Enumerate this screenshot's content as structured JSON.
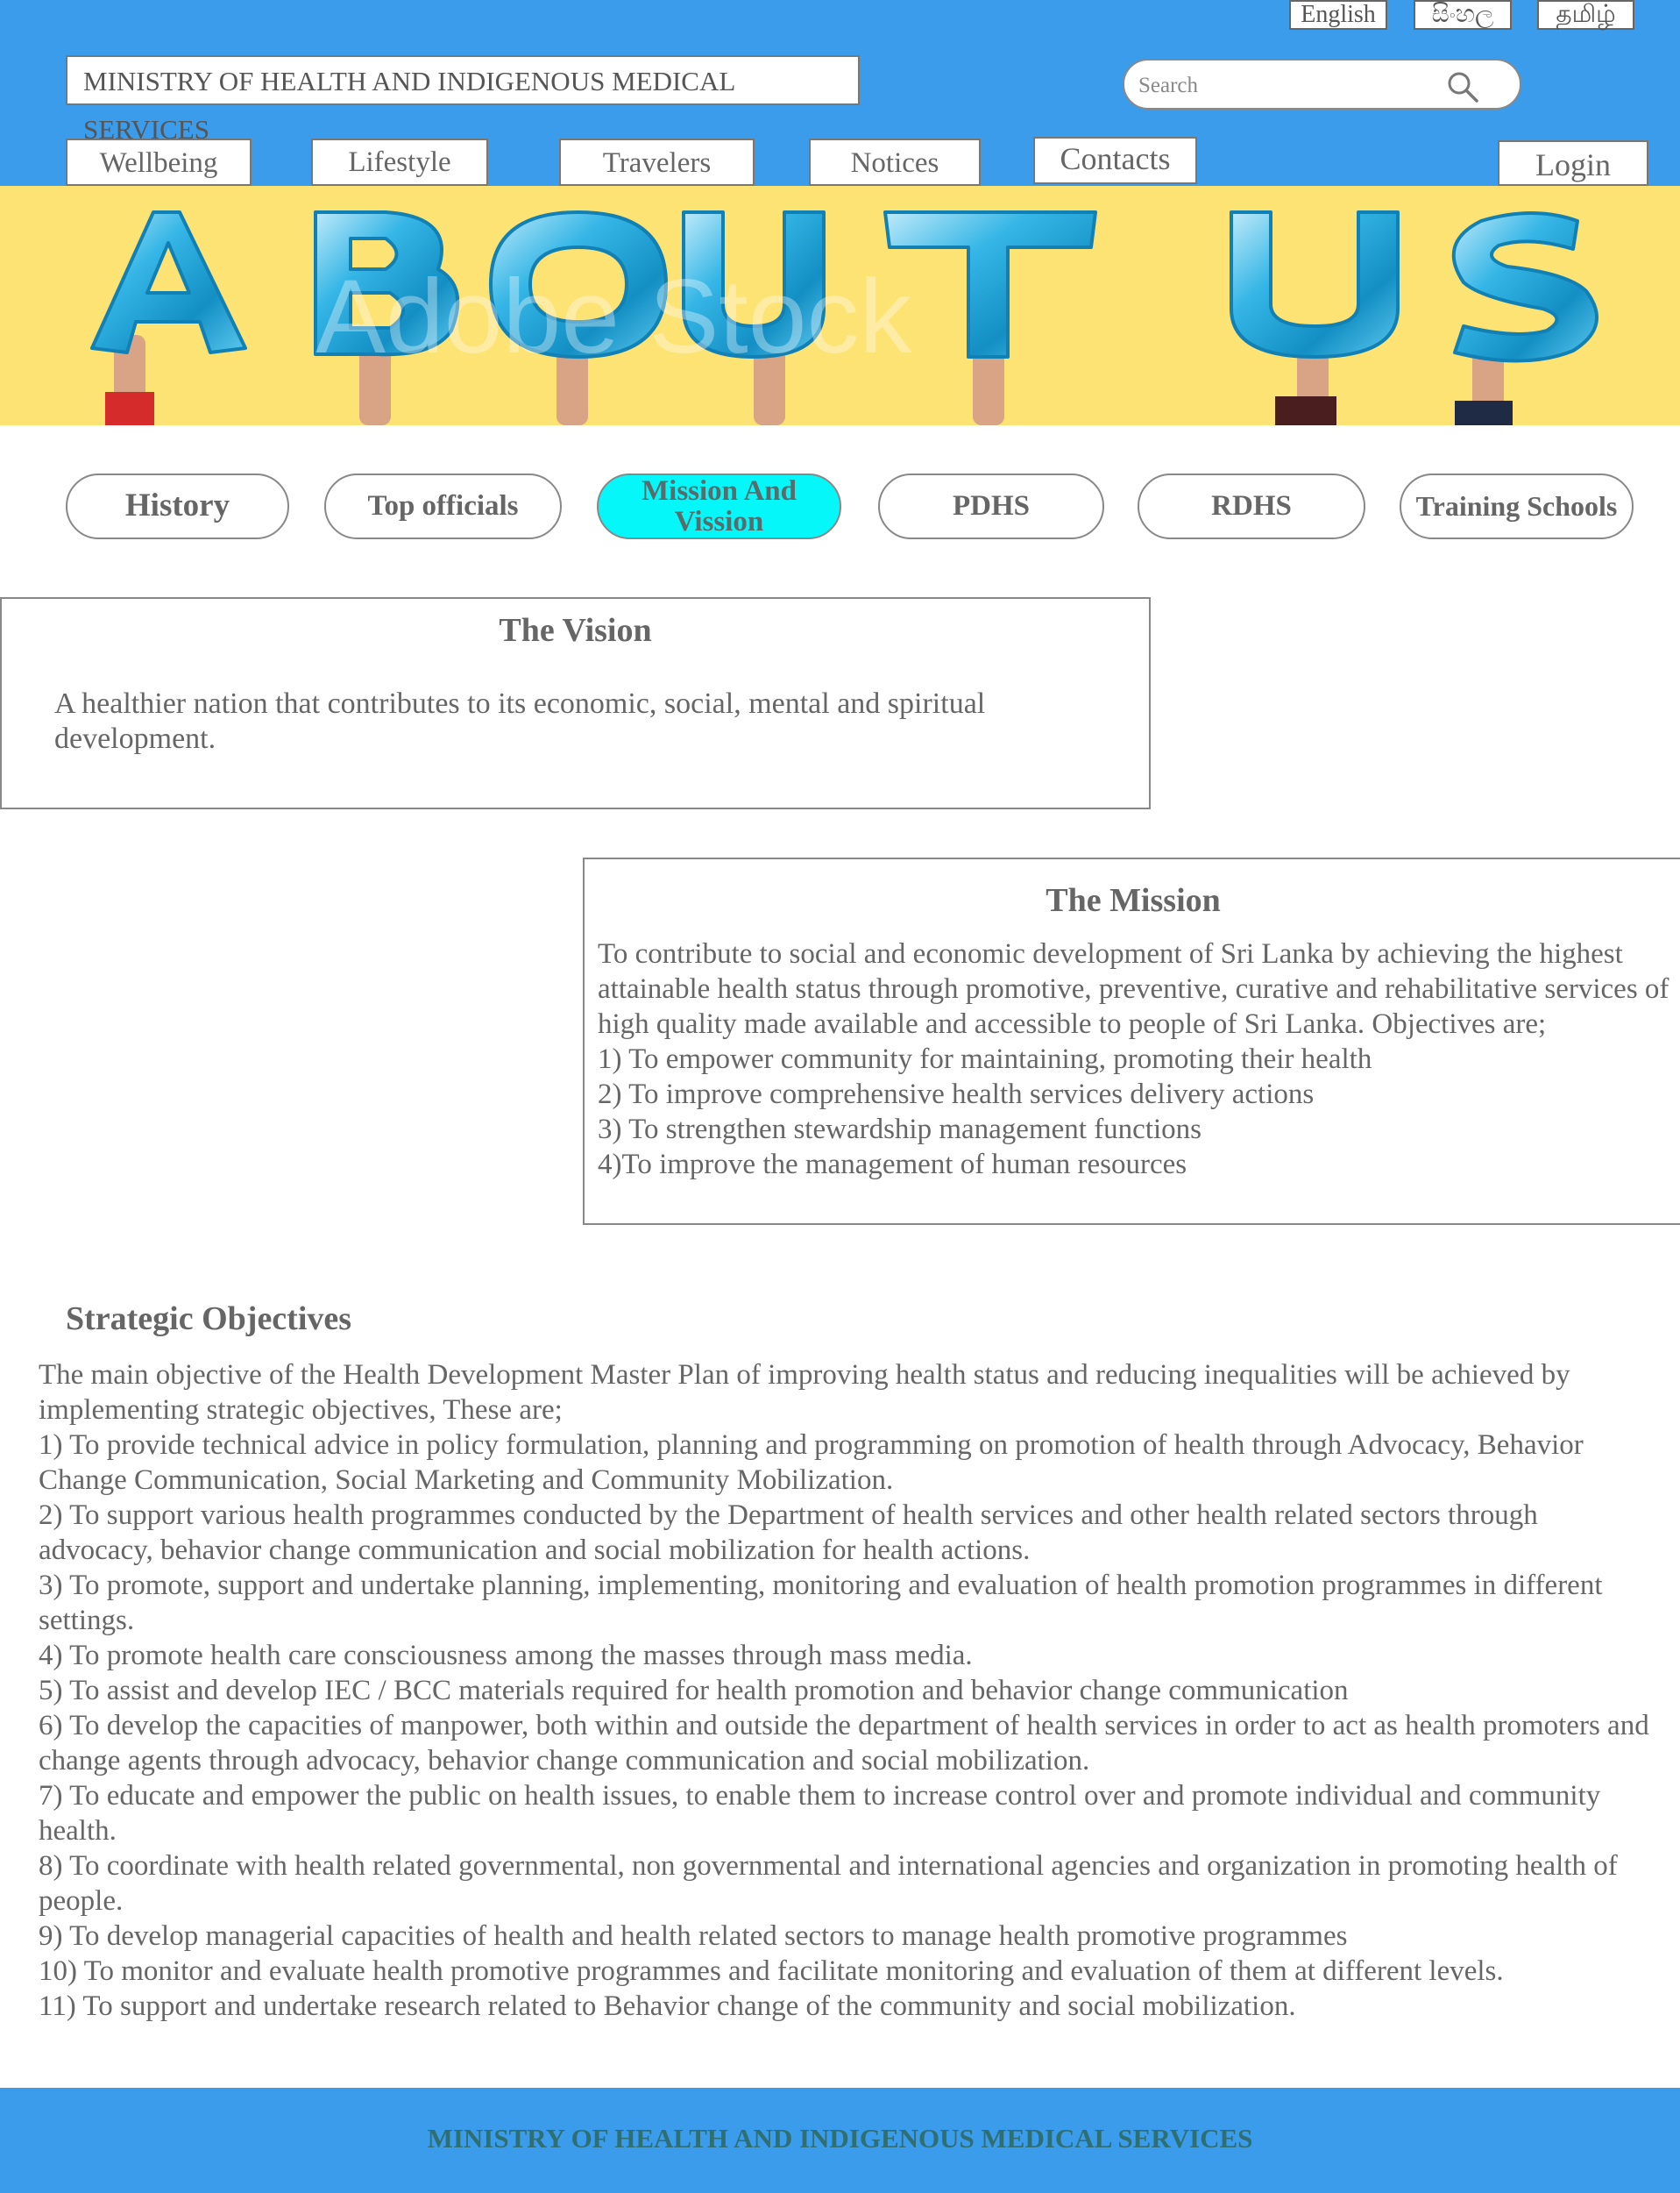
{
  "header": {
    "languages": [
      "English",
      "සිංහල",
      "தமிழ்"
    ],
    "ministry_title": "MINISTRY OF HEALTH AND INDIGENOUS MEDICAL SERVICES",
    "search_placeholder": "Search",
    "nav": [
      "Wellbeing",
      "Lifestyle",
      "Travelers",
      "Notices",
      "Contacts"
    ],
    "login": "Login",
    "bg_color": "#3b9ceb"
  },
  "banner": {
    "text": "ABOUT US",
    "watermark": "Adobe Stock",
    "bg_color": "#fde274",
    "balloon_color": "#1aa3d8"
  },
  "tabs": {
    "items": [
      "History",
      "Top officials",
      "Mission And Vission",
      "PDHS",
      "RDHS",
      "Training Schools"
    ],
    "active": "Mission And Vission",
    "active_color": "#05f7f9"
  },
  "vision": {
    "title": "The Vision",
    "text": "A healthier nation that contributes to its economic, social, mental and spiritual development."
  },
  "mission": {
    "title": "The Mission",
    "lines": [
      "To contribute to social and economic development of Sri Lanka by achieving the highest attainable health status through promotive, preventive, curative and rehabilitative services of high quality made available and accessible to people of Sri Lanka. Objectives are;",
      "1) To empower community for maintaining, promoting their health",
      "2) To improve comprehensive health services delivery actions",
      "3) To strengthen stewardship management functions",
      "4)To improve the management of human resources"
    ]
  },
  "strategic": {
    "title": "Strategic Objectives",
    "lines": [
      "The main objective of the Health Development Master Plan of improving health status and reducing inequalities will be achieved by implementing strategic objectives, These are;",
      "1) To provide technical advice in policy formulation, planning and programming on promotion of health through Advocacy, Behavior Change Communication, Social Marketing and Community Mobilization.",
      "2) To support various health programmes conducted by the Department of health services and other health related sectors through advocacy, behavior change communication and social mobilization for health actions.",
      "3) To promote, support and undertake planning, implementing, monitoring and evaluation of health promotion programmes in different settings.",
      "4) To promote health care consciousness among the masses through mass media.",
      "5) To assist and develop IEC / BCC materials required for health promotion and behavior change communication",
      "6) To develop the capacities of manpower, both within and outside the department of health services in order to act as health promoters and change agents through advocacy, behavior change communication and social mobilization.",
      "7) To educate and empower the public on health issues, to enable them to increase control over and promote individual and community health.",
      "8) To coordinate with health related governmental, non governmental and international agencies and organization in promoting health of people.",
      "9) To develop managerial capacities of health and health related sectors to manage health promotive programmes",
      "10) To monitor and evaluate health promotive programmes and facilitate monitoring and evaluation of them at different levels.",
      "11) To support and undertake research related to Behavior change of the community and social mobilization."
    ]
  },
  "footer": {
    "text": "MINISTRY OF HEALTH AND INDIGENOUS MEDICAL SERVICES"
  },
  "icons": {
    "search": "search-icon"
  }
}
